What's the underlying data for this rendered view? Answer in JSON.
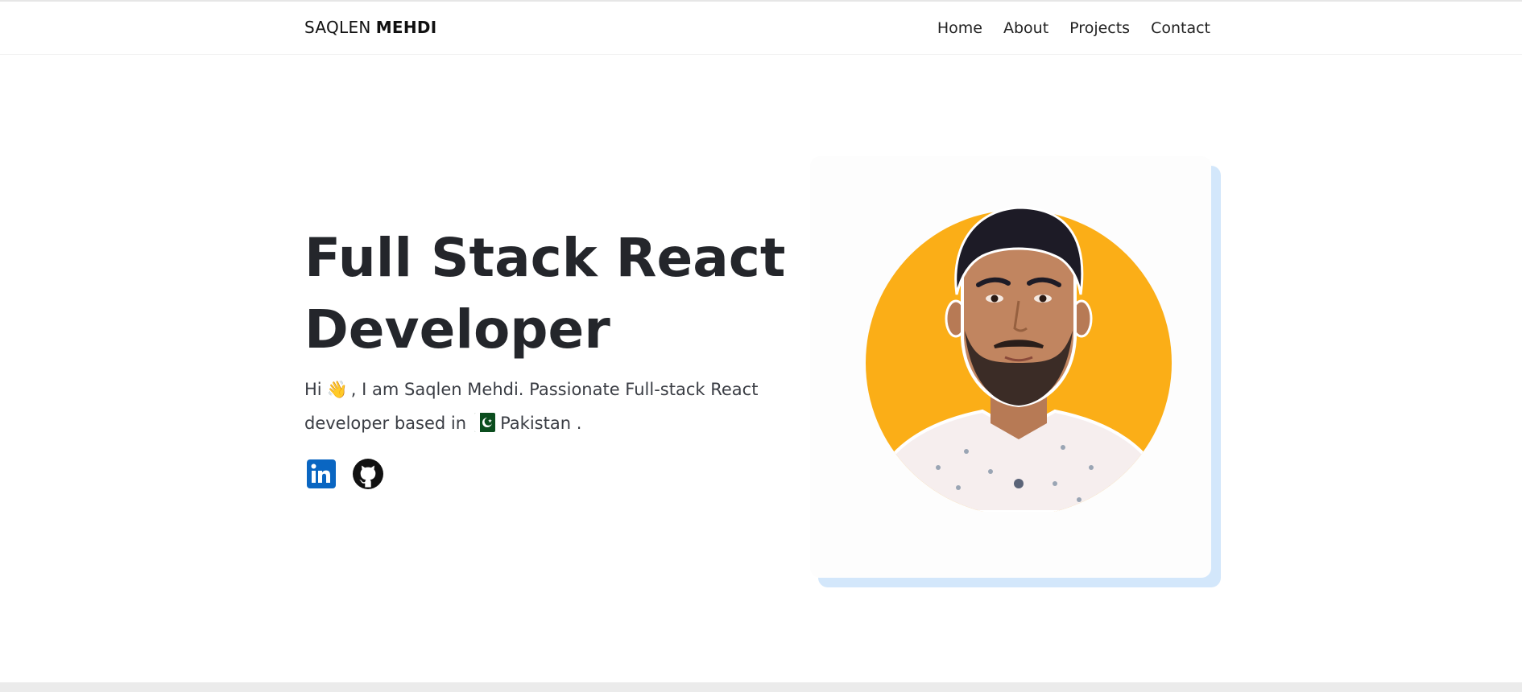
{
  "brand": {
    "first": "SAQLEN",
    "last": "MEHDI"
  },
  "nav": [
    "Home",
    "About",
    "Projects",
    "Contact"
  ],
  "hero": {
    "title_line1": "Full Stack React",
    "title_line2": "Developer",
    "intro_before": "Hi",
    "wave_emoji": "👋",
    "intro_middle": ", I am Saqlen Mehdi. Passionate Full-stack React developer based in",
    "country": "Pakistan",
    "intro_end": "."
  },
  "icons": {
    "linkedin": "linkedin-icon",
    "github": "github-icon",
    "flag": "pakistan-flag-icon"
  },
  "colors": {
    "accent_circle": "#fbae17",
    "card_shadow": "#d3e7fb",
    "linkedin": "#0a66c2",
    "text": "#24262b"
  }
}
